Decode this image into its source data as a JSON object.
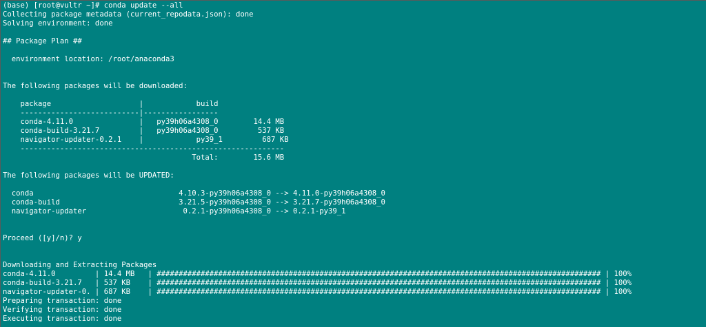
{
  "terminal": {
    "background": "#008080",
    "foreground": "#ffffff",
    "lines": [
      {
        "row": 0,
        "text": "(base) [root@vultr ~]# conda update --all"
      },
      {
        "row": 1,
        "text": "Collecting package metadata (current_repodata.json): done"
      },
      {
        "row": 2,
        "text": "Solving environment: done"
      },
      {
        "row": 4,
        "text": "## Package Plan ##"
      },
      {
        "row": 6,
        "text": "  environment location: /root/anaconda3"
      },
      {
        "row": 9,
        "text": "The following packages will be downloaded:"
      },
      {
        "row": 11,
        "text": "    package                    |            build"
      },
      {
        "row": 12,
        "text": "    ---------------------------|-----------------"
      },
      {
        "row": 13,
        "text": "    conda-4.11.0               |   py39h06a4308_0        14.4 MB"
      },
      {
        "row": 14,
        "text": "    conda-build-3.21.7         |   py39h06a4308_0         537 KB"
      },
      {
        "row": 15,
        "text": "    navigator-updater-0.2.1    |            py39_1         687 KB"
      },
      {
        "row": 16,
        "text": "    ------------------------------------------------------------"
      },
      {
        "row": 17,
        "text": "                                           Total:        15.6 MB"
      },
      {
        "row": 19,
        "text": "The following packages will be UPDATED:"
      },
      {
        "row": 21,
        "text": "  conda                                 4.10.3-py39h06a4308_0 --> 4.11.0-py39h06a4308_0"
      },
      {
        "row": 22,
        "text": "  conda-build                           3.21.5-py39h06a4308_0 --> 3.21.7-py39h06a4308_0"
      },
      {
        "row": 23,
        "text": "  navigator-updater                      0.2.1-py39h06a4308_0 --> 0.2.1-py39_1"
      },
      {
        "row": 26,
        "text": "Proceed ([y]/n)? y"
      },
      {
        "row": 29,
        "text": "Downloading and Extracting Packages"
      },
      {
        "row": 30,
        "text": "conda-4.11.0         | 14.4 MB   | ##################################################################################################### | 100%"
      },
      {
        "row": 31,
        "text": "conda-build-3.21.7   | 537 KB    | ##################################################################################################### | 100%"
      },
      {
        "row": 32,
        "text": "navigator-updater-0. | 687 KB    | ##################################################################################################### | 100%"
      },
      {
        "row": 33,
        "text": "Preparing transaction: done"
      },
      {
        "row": 34,
        "text": "Verifying transaction: done"
      },
      {
        "row": 35,
        "text": "Executing transaction: done"
      }
    ]
  }
}
